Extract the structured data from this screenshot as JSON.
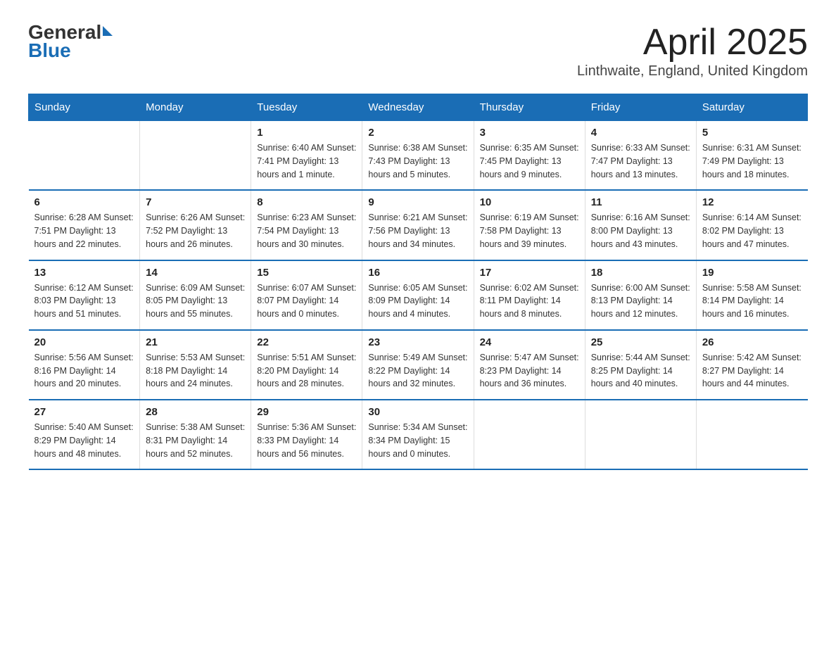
{
  "header": {
    "logo_general": "General",
    "logo_blue": "Blue",
    "title": "April 2025",
    "location": "Linthwaite, England, United Kingdom"
  },
  "days_of_week": [
    "Sunday",
    "Monday",
    "Tuesday",
    "Wednesday",
    "Thursday",
    "Friday",
    "Saturday"
  ],
  "weeks": [
    [
      {
        "day": "",
        "info": ""
      },
      {
        "day": "",
        "info": ""
      },
      {
        "day": "1",
        "info": "Sunrise: 6:40 AM\nSunset: 7:41 PM\nDaylight: 13 hours and 1 minute."
      },
      {
        "day": "2",
        "info": "Sunrise: 6:38 AM\nSunset: 7:43 PM\nDaylight: 13 hours and 5 minutes."
      },
      {
        "day": "3",
        "info": "Sunrise: 6:35 AM\nSunset: 7:45 PM\nDaylight: 13 hours and 9 minutes."
      },
      {
        "day": "4",
        "info": "Sunrise: 6:33 AM\nSunset: 7:47 PM\nDaylight: 13 hours and 13 minutes."
      },
      {
        "day": "5",
        "info": "Sunrise: 6:31 AM\nSunset: 7:49 PM\nDaylight: 13 hours and 18 minutes."
      }
    ],
    [
      {
        "day": "6",
        "info": "Sunrise: 6:28 AM\nSunset: 7:51 PM\nDaylight: 13 hours and 22 minutes."
      },
      {
        "day": "7",
        "info": "Sunrise: 6:26 AM\nSunset: 7:52 PM\nDaylight: 13 hours and 26 minutes."
      },
      {
        "day": "8",
        "info": "Sunrise: 6:23 AM\nSunset: 7:54 PM\nDaylight: 13 hours and 30 minutes."
      },
      {
        "day": "9",
        "info": "Sunrise: 6:21 AM\nSunset: 7:56 PM\nDaylight: 13 hours and 34 minutes."
      },
      {
        "day": "10",
        "info": "Sunrise: 6:19 AM\nSunset: 7:58 PM\nDaylight: 13 hours and 39 minutes."
      },
      {
        "day": "11",
        "info": "Sunrise: 6:16 AM\nSunset: 8:00 PM\nDaylight: 13 hours and 43 minutes."
      },
      {
        "day": "12",
        "info": "Sunrise: 6:14 AM\nSunset: 8:02 PM\nDaylight: 13 hours and 47 minutes."
      }
    ],
    [
      {
        "day": "13",
        "info": "Sunrise: 6:12 AM\nSunset: 8:03 PM\nDaylight: 13 hours and 51 minutes."
      },
      {
        "day": "14",
        "info": "Sunrise: 6:09 AM\nSunset: 8:05 PM\nDaylight: 13 hours and 55 minutes."
      },
      {
        "day": "15",
        "info": "Sunrise: 6:07 AM\nSunset: 8:07 PM\nDaylight: 14 hours and 0 minutes."
      },
      {
        "day": "16",
        "info": "Sunrise: 6:05 AM\nSunset: 8:09 PM\nDaylight: 14 hours and 4 minutes."
      },
      {
        "day": "17",
        "info": "Sunrise: 6:02 AM\nSunset: 8:11 PM\nDaylight: 14 hours and 8 minutes."
      },
      {
        "day": "18",
        "info": "Sunrise: 6:00 AM\nSunset: 8:13 PM\nDaylight: 14 hours and 12 minutes."
      },
      {
        "day": "19",
        "info": "Sunrise: 5:58 AM\nSunset: 8:14 PM\nDaylight: 14 hours and 16 minutes."
      }
    ],
    [
      {
        "day": "20",
        "info": "Sunrise: 5:56 AM\nSunset: 8:16 PM\nDaylight: 14 hours and 20 minutes."
      },
      {
        "day": "21",
        "info": "Sunrise: 5:53 AM\nSunset: 8:18 PM\nDaylight: 14 hours and 24 minutes."
      },
      {
        "day": "22",
        "info": "Sunrise: 5:51 AM\nSunset: 8:20 PM\nDaylight: 14 hours and 28 minutes."
      },
      {
        "day": "23",
        "info": "Sunrise: 5:49 AM\nSunset: 8:22 PM\nDaylight: 14 hours and 32 minutes."
      },
      {
        "day": "24",
        "info": "Sunrise: 5:47 AM\nSunset: 8:23 PM\nDaylight: 14 hours and 36 minutes."
      },
      {
        "day": "25",
        "info": "Sunrise: 5:44 AM\nSunset: 8:25 PM\nDaylight: 14 hours and 40 minutes."
      },
      {
        "day": "26",
        "info": "Sunrise: 5:42 AM\nSunset: 8:27 PM\nDaylight: 14 hours and 44 minutes."
      }
    ],
    [
      {
        "day": "27",
        "info": "Sunrise: 5:40 AM\nSunset: 8:29 PM\nDaylight: 14 hours and 48 minutes."
      },
      {
        "day": "28",
        "info": "Sunrise: 5:38 AM\nSunset: 8:31 PM\nDaylight: 14 hours and 52 minutes."
      },
      {
        "day": "29",
        "info": "Sunrise: 5:36 AM\nSunset: 8:33 PM\nDaylight: 14 hours and 56 minutes."
      },
      {
        "day": "30",
        "info": "Sunrise: 5:34 AM\nSunset: 8:34 PM\nDaylight: 15 hours and 0 minutes."
      },
      {
        "day": "",
        "info": ""
      },
      {
        "day": "",
        "info": ""
      },
      {
        "day": "",
        "info": ""
      }
    ]
  ]
}
